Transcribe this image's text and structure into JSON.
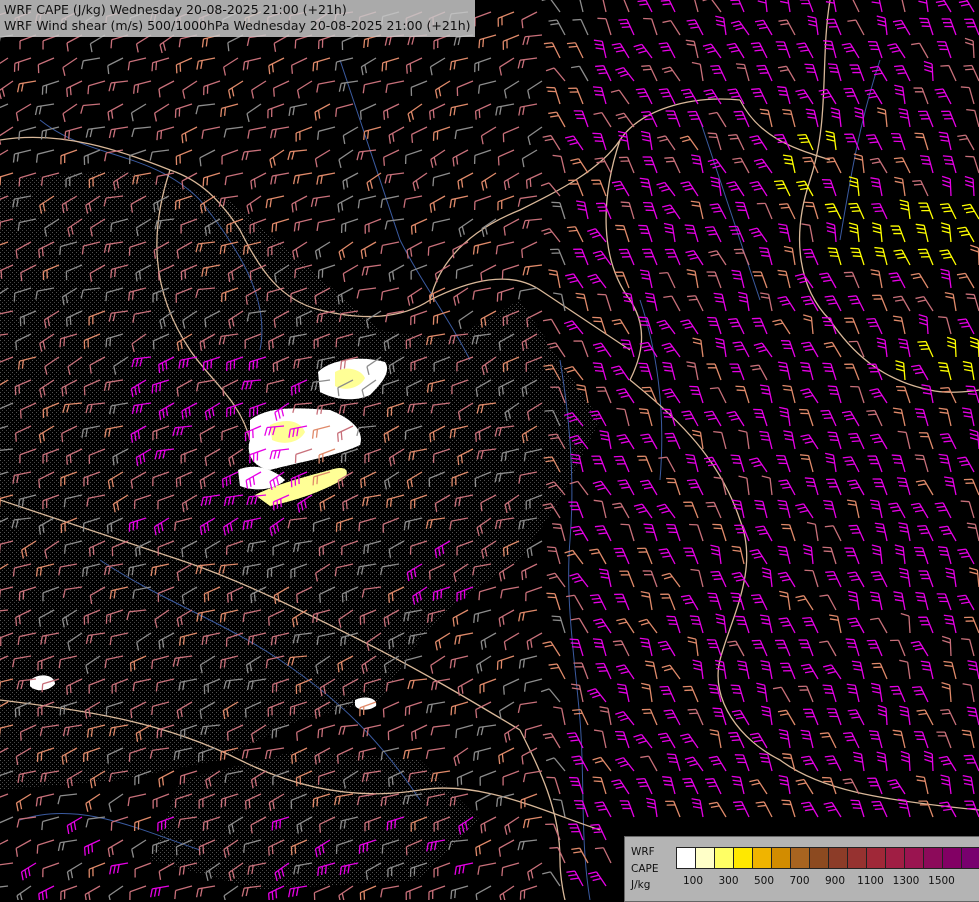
{
  "header": {
    "line1": "WRF CAPE (J/kg) Wednesday 20-08-2025 21:00 (+21h)",
    "line2": "WRF Wind shear (m/s) 500/1000hPa Wednesday 20-08-2025 21:00 (+21h)"
  },
  "legend": {
    "line1": "WRF",
    "line2": "CAPE",
    "line3": "J/kg",
    "colors": [
      "#ffffff",
      "#ffffc8",
      "#ffff64",
      "#ffe800",
      "#f0b400",
      "#d28c00",
      "#a86420",
      "#8c4a20",
      "#8c3c28",
      "#963230",
      "#a02838",
      "#a01e44",
      "#9a1450",
      "#8c0a5a",
      "#820064",
      "#78006e",
      "#6e0078"
    ],
    "ticks": [
      "100",
      "300",
      "500",
      "700",
      "900",
      "1100",
      "1300",
      "1500"
    ]
  },
  "map": {
    "barb_colors": {
      "weak": "#8c8c8c",
      "moderate": "#c8707a",
      "strong": "#e08a6a",
      "very_strong": "#e600e6",
      "extreme": "#ffff00"
    },
    "cape_colors": {
      "low": "#ffffff",
      "mid": "#ffff96",
      "high": "#f0e040"
    }
  }
}
